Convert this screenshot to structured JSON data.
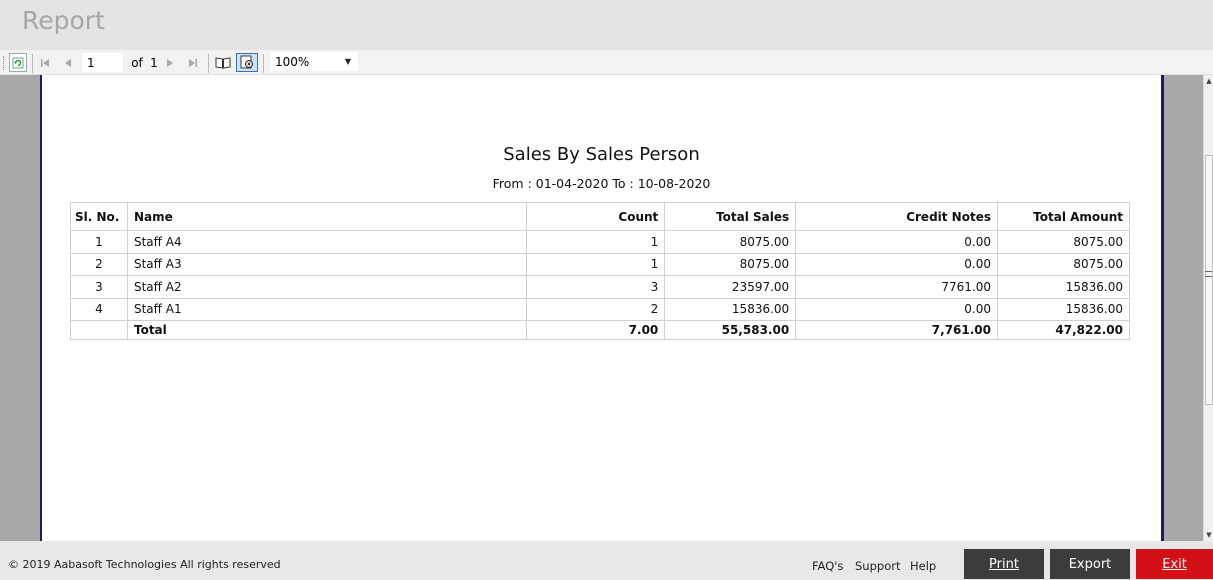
{
  "app": {
    "title": "Report"
  },
  "toolbar": {
    "page_value": "1",
    "of_label": "of",
    "total_pages": "1",
    "zoom": "100%"
  },
  "report": {
    "title": "Sales By Sales Person",
    "range": "From : 01-04-2020 To : 10-08-2020",
    "columns": [
      "Sl. No.",
      "Name",
      "Count",
      "Total Sales",
      "Credit Notes",
      "Total Amount"
    ],
    "rows": [
      {
        "sl": "1",
        "name": "Staff A4",
        "count": "1",
        "total_sales": "8075.00",
        "credit_notes": "0.00",
        "total_amount": "8075.00"
      },
      {
        "sl": "2",
        "name": "Staff A3",
        "count": "1",
        "total_sales": "8075.00",
        "credit_notes": "0.00",
        "total_amount": "8075.00"
      },
      {
        "sl": "3",
        "name": "Staff A2",
        "count": "3",
        "total_sales": "23597.00",
        "credit_notes": "7761.00",
        "total_amount": "15836.00"
      },
      {
        "sl": "4",
        "name": "Staff A1",
        "count": "2",
        "total_sales": "15836.00",
        "credit_notes": "0.00",
        "total_amount": "15836.00"
      }
    ],
    "total": {
      "label": "Total",
      "count": "7.00",
      "total_sales": "55,583.00",
      "credit_notes": "7,761.00",
      "total_amount": "47,822.00"
    }
  },
  "footer": {
    "copyright": "© 2019 Aabasoft Technologies All rights reserved",
    "links": {
      "faq": "FAQ's",
      "support": "Support",
      "help": "Help"
    },
    "buttons": {
      "print": "Print",
      "export": "Export",
      "exit": "Exit"
    }
  },
  "colors": {
    "exit": "#d31016",
    "dark_button": "#3c3c3c",
    "page_border": "#1a1a6e"
  }
}
